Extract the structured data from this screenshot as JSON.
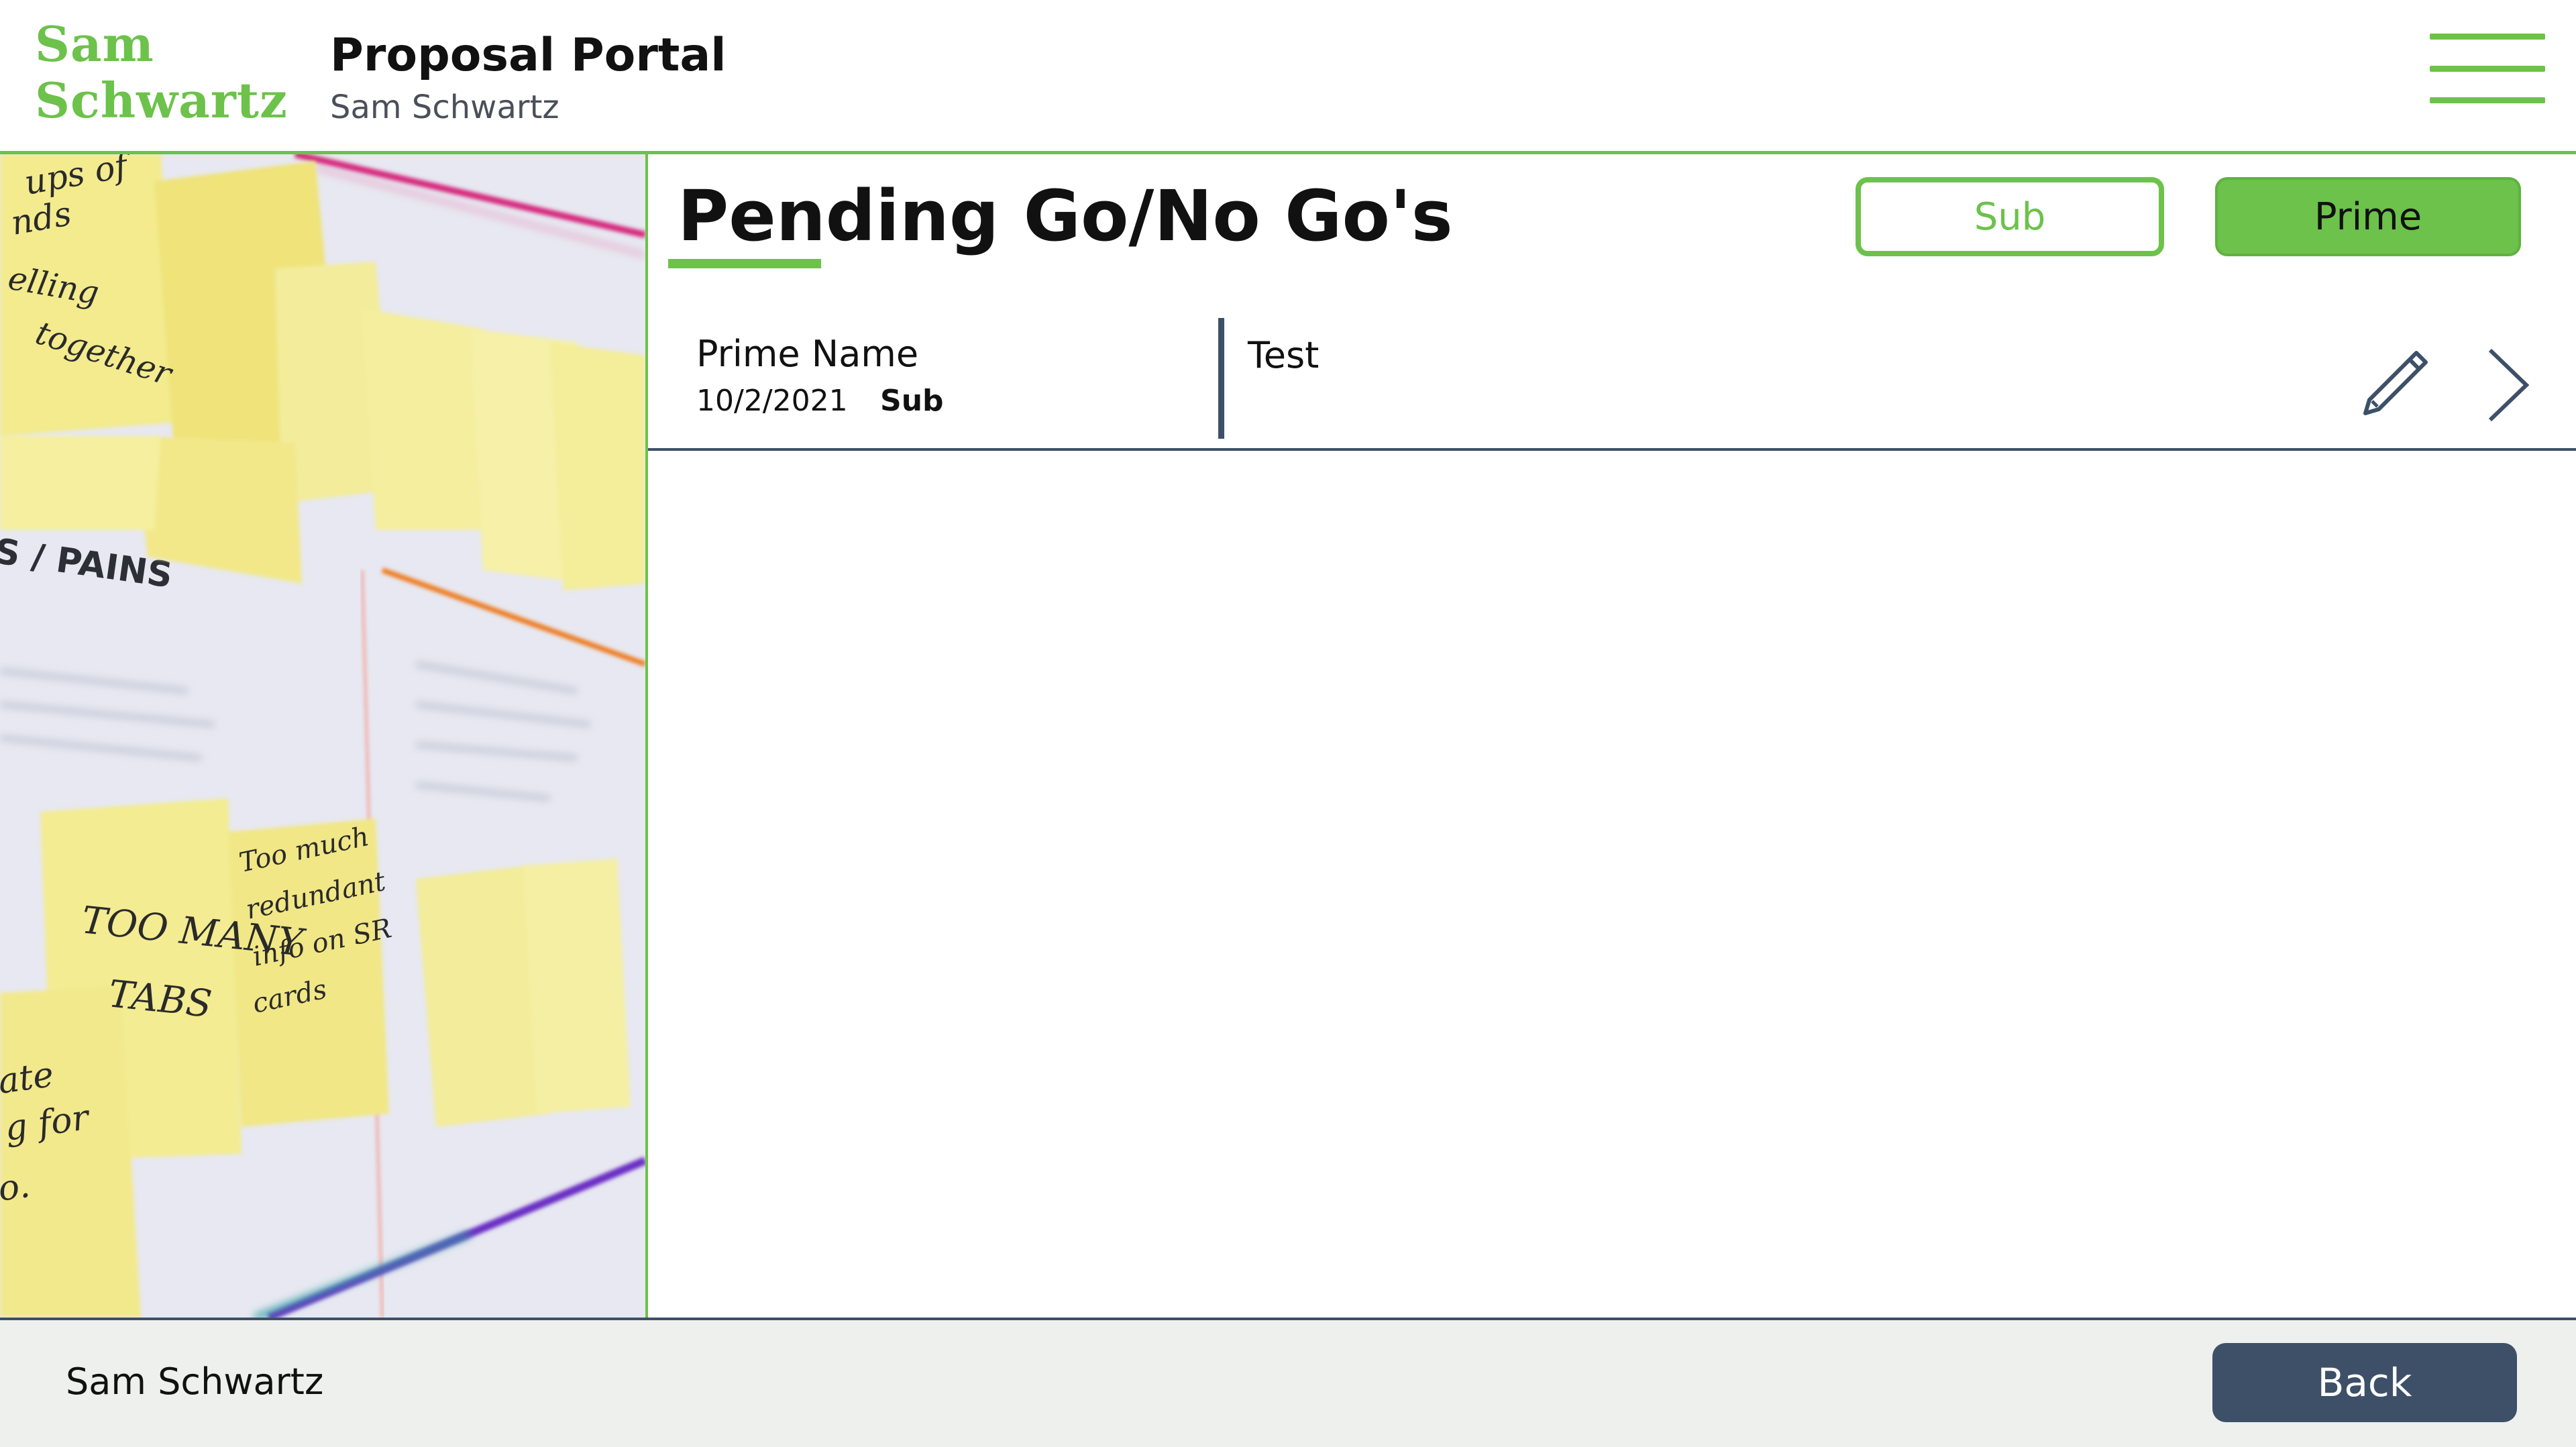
{
  "brand": {
    "logo_line1": "Sam",
    "logo_line2": "Schwartz",
    "accent_color": "#6cc24a",
    "navy_color": "#3d5068"
  },
  "header": {
    "title": "Proposal Portal",
    "subtitle": "Sam Schwartz",
    "menu_icon": "hamburger-menu-icon"
  },
  "hero": {
    "icon": "sticky-notes-photo",
    "notes": [
      "Too MANY TABS",
      "trips of friends travelling together",
      "S / PAINS"
    ]
  },
  "main": {
    "page_title": "Pending Go/No Go's",
    "filters": {
      "sub_label": "Sub",
      "prime_label": "Prime"
    },
    "items": [
      {
        "name": "Prime Name",
        "date": "10/2/2021",
        "type": "Sub",
        "description": "Test",
        "edit_icon": "pencil-icon",
        "open_icon": "chevron-right-icon"
      }
    ]
  },
  "footer": {
    "label": "Sam Schwartz",
    "back_label": "Back"
  }
}
